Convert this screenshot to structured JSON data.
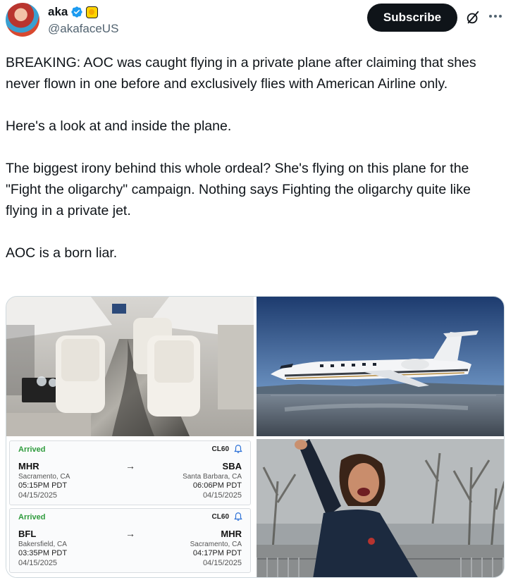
{
  "author": {
    "display_name": "aka",
    "handle": "@akafaceUS",
    "verified_icon": "verified-badge-icon",
    "affiliation_icon": "affiliation-badge-icon"
  },
  "actions": {
    "subscribe_label": "Subscribe",
    "grok_icon": "grok-icon",
    "more_icon": "more-options-icon"
  },
  "tweet": {
    "paragraphs": [
      "BREAKING: AOC was caught flying in a private plane after claiming that shes never flown in one before and exclusively flies with American Airline only.",
      "Here's a look at and inside the plane.",
      "The biggest irony behind this whole ordeal? She's flying on this plane for the \"Fight the oligarchy\" campaign. Nothing says Fighting the oligarchy quite like flying in a private jet.",
      "AOC is a born liar."
    ]
  },
  "media": {
    "flights": [
      {
        "status": "Arrived",
        "aircraft": "CL60",
        "from_code": "MHR",
        "from_city": "Sacramento, CA",
        "from_time": "05:15PM PDT",
        "from_date": "04/15/2025",
        "to_code": "SBA",
        "to_city": "Santa Barbara, CA",
        "to_time": "06:06PM PDT",
        "to_date": "04/15/2025",
        "arrow": "→"
      },
      {
        "status": "Arrived",
        "aircraft": "CL60",
        "from_code": "BFL",
        "from_city": "Bakersfield, CA",
        "from_time": "03:35PM PDT",
        "from_date": "04/15/2025",
        "to_code": "MHR",
        "to_city": "Sacramento, CA",
        "to_time": "04:17PM PDT",
        "to_date": "04/15/2025",
        "arrow": "→"
      }
    ]
  },
  "colors": {
    "subscribe_bg": "#0f1419",
    "verified_blue": "#1d9bf0",
    "arrived_green": "#2e9b3c",
    "muted_text": "#536471"
  }
}
